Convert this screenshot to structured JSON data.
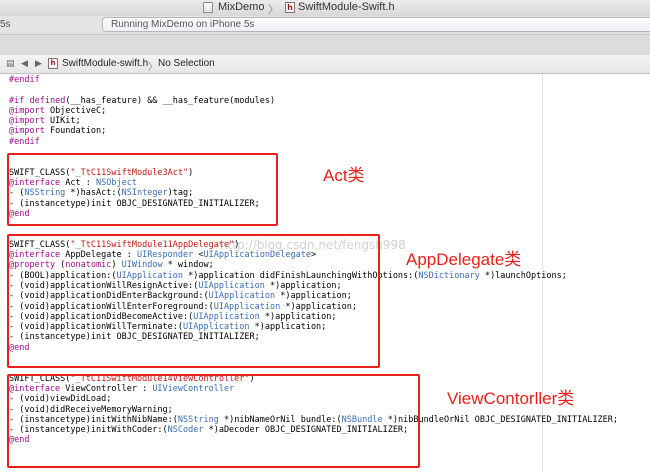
{
  "titlebar": {
    "project_name": "MixDemo",
    "file_name": "SwiftModule-Swift.h",
    "separator": "〉"
  },
  "toolbar": {
    "scheme_fragment": "5s",
    "status": "Running MixDemo on iPhone 5s"
  },
  "jumpbar": {
    "file": "SwiftModule-swift.h",
    "separator": "〉",
    "selection": "No Selection"
  },
  "code_lines": [
    "#endif",
    "",
    "#if defined(__has_feature) && __has_feature(modules)",
    "@import ObjectiveC;",
    "@import UIKit;",
    "@import Foundation;",
    "#endif",
    "",
    "",
    "SWIFT_CLASS(\"_TtC11SwiftModule3Act\")",
    "@interface Act : NSObject",
    "- (NSString *)hasAct:(NSInteger)tag;",
    "- (instancetype)init OBJC_DESIGNATED_INITIALIZER;",
    "@end",
    "",
    "",
    "SWIFT_CLASS(\"_TtC11SwiftModule11AppDelegate\")",
    "@interface AppDelegate : UIResponder <UIApplicationDelegate>",
    "@property (nonatomic) UIWindow * window;",
    "- (BOOL)application:(UIApplication *)application didFinishLaunchingWithOptions:(NSDictionary *)launchOptions;",
    "- (void)applicationWillResignActive:(UIApplication *)application;",
    "- (void)applicationDidEnterBackground:(UIApplication *)application;",
    "- (void)applicationWillEnterForeground:(UIApplication *)application;",
    "- (void)applicationDidBecomeActive:(UIApplication *)application;",
    "- (void)applicationWillTerminate:(UIApplication *)application;",
    "- (instancetype)init OBJC_DESIGNATED_INITIALIZER;",
    "@end",
    "",
    "",
    "SWIFT_CLASS(\"_TtC11SwiftModule14ViewController\")",
    "@interface ViewController : UIViewController",
    "- (void)viewDidLoad;",
    "- (void)didReceiveMemoryWarning;",
    "- (instancetype)initWithNibName:(NSString *)nibNameOrNil bundle:(NSBundle *)nibBundleOrNil OBJC_DESIGNATED_INITIALIZER;",
    "- (instancetype)initWithCoder:(NSCoder *)aDecoder OBJC_DESIGNATED_INITIALIZER;",
    "@end"
  ],
  "annotations": {
    "act": "Act类",
    "app_delegate": "AppDelegate类",
    "view_controller": "ViewContorller类"
  },
  "watermark": "http://blog.csdn.net/fengsh998",
  "colors": {
    "annotation_red": "#e8201c",
    "keyword": "#a10c90",
    "type": "#3b6cb0",
    "string": "#c41a16"
  },
  "icons": {
    "project": "xcode-project-icon",
    "header_file": "header-file-icon",
    "nav_back": "chevron-left-icon",
    "nav_forward": "chevron-right-icon"
  }
}
